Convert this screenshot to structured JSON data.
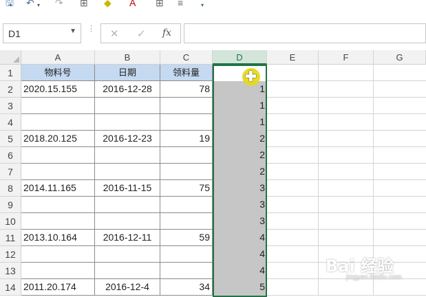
{
  "toolbar": {
    "icons": [
      "save-icon",
      "undo-icon",
      "redo-icon",
      "borders-icon",
      "fill-color-icon",
      "font-color-icon",
      "table-icon",
      "align-icon",
      "customize-icon"
    ]
  },
  "formula_bar": {
    "name_box": "D1",
    "fx_label": "fx",
    "cancel_glyph": "✕",
    "enter_glyph": "✓",
    "formula": ""
  },
  "sheet": {
    "columns": [
      "A",
      "B",
      "C",
      "D",
      "E",
      "F",
      "G"
    ],
    "selected_column": "D",
    "rows": [
      {
        "num": "1",
        "a": "物料号",
        "b": "日期",
        "c": "领料量",
        "d": ""
      },
      {
        "num": "2",
        "a": "2020.15.155",
        "b": "2016-12-28",
        "c": "78",
        "d": "1"
      },
      {
        "num": "3",
        "a": "",
        "b": "",
        "c": "",
        "d": "1"
      },
      {
        "num": "4",
        "a": "",
        "b": "",
        "c": "",
        "d": "1"
      },
      {
        "num": "5",
        "a": "2018.20.125",
        "b": "2016-12-23",
        "c": "19",
        "d": "2"
      },
      {
        "num": "6",
        "a": "",
        "b": "",
        "c": "",
        "d": "2"
      },
      {
        "num": "7",
        "a": "",
        "b": "",
        "c": "",
        "d": "2"
      },
      {
        "num": "8",
        "a": "2014.11.165",
        "b": "2016-11-15",
        "c": "75",
        "d": "3"
      },
      {
        "num": "9",
        "a": "",
        "b": "",
        "c": "",
        "d": "3"
      },
      {
        "num": "10",
        "a": "",
        "b": "",
        "c": "",
        "d": "3"
      },
      {
        "num": "11",
        "a": "2013.10.164",
        "b": "2016-12-11",
        "c": "59",
        "d": "4"
      },
      {
        "num": "12",
        "a": "",
        "b": "",
        "c": "",
        "d": "4"
      },
      {
        "num": "13",
        "a": "",
        "b": "",
        "c": "",
        "d": "4"
      },
      {
        "num": "14",
        "a": "2011.20.174",
        "b": "2016-12-4",
        "c": "34",
        "d": "5"
      }
    ]
  },
  "watermark": {
    "brand": "Bai  经验",
    "url": "jingyan.baidu.com"
  },
  "colors": {
    "accent": "#217346",
    "header_fill": "#c5d9f1",
    "selection_fill": "#c6c6c6",
    "cursor": "#e3db1e"
  }
}
